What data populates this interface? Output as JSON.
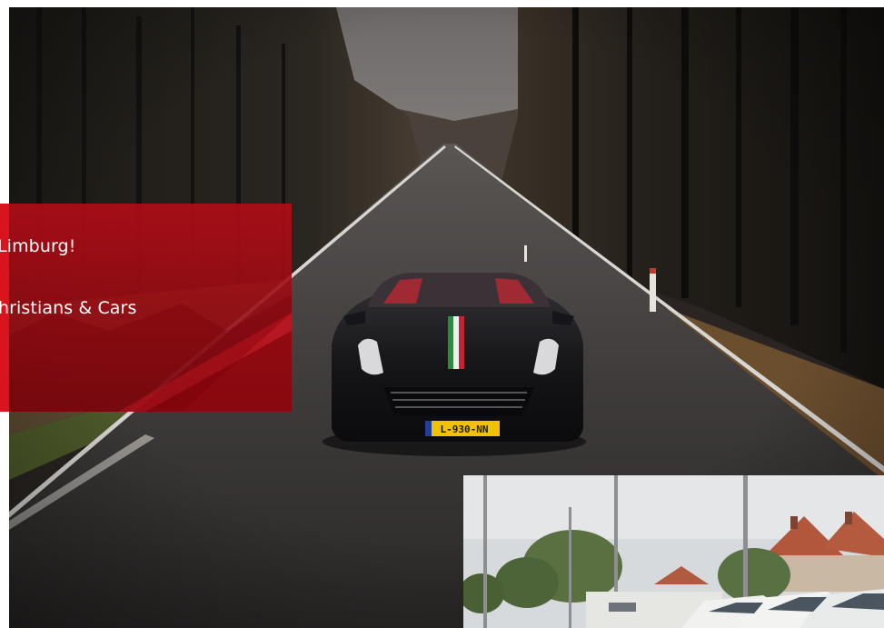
{
  "promo": {
    "line1": "Limburg!",
    "line2": "hristians & Cars"
  },
  "hero": {
    "plate": "L-930-NN"
  },
  "colors": {
    "promo_red": "#b00c16",
    "accent_red": "#d9141f",
    "plate_yellow": "#f2c200",
    "plate_blue": "#1f3f9a"
  },
  "images": {
    "hero": "road-forest-car-photo",
    "inset": "parking-lot-photo"
  }
}
